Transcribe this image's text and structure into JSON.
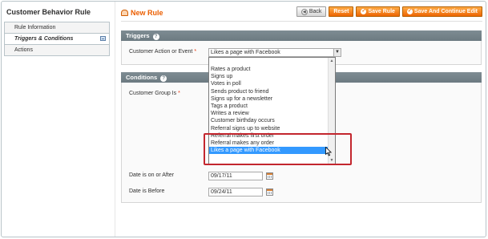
{
  "sidebar": {
    "title": "Customer Behavior Rule",
    "tabs": [
      {
        "label": "Rule Information"
      },
      {
        "label": "Triggers & Conditions"
      },
      {
        "label": "Actions"
      }
    ]
  },
  "header": {
    "title": "New Rule",
    "buttons": {
      "back": "Back",
      "reset": "Reset",
      "save": "Save Rule",
      "save_continue": "Save And Continue Edit"
    }
  },
  "triggers": {
    "heading": "Triggers",
    "action_label": "Customer Action or Event",
    "required_mark": "*",
    "selected_value": "Likes a page with Facebook"
  },
  "conditions": {
    "heading": "Conditions",
    "group_label": "Customer Group Is",
    "required_mark": "*",
    "date_after_label": "Date is on or After",
    "date_after_value": "09/17/11",
    "date_before_label": "Date is Before",
    "date_before_value": "09/24/11"
  },
  "dropdown_options": [
    "Rates a product",
    "Signs up",
    "Votes in poll",
    "Sends product to friend",
    "Signs up for a newsletter",
    "Tags a product",
    "Writes a review",
    "Customer birthday occurs",
    "Referral signs up to website",
    "Referral makes first order",
    "Referral makes any order",
    "Likes a page with Facebook"
  ],
  "dropdown_selected_index": 11,
  "colors": {
    "accent_orange": "#eb5e00",
    "section_header": "#6c7a81",
    "selection_blue": "#3399ff",
    "highlight_red": "#c3262e"
  }
}
